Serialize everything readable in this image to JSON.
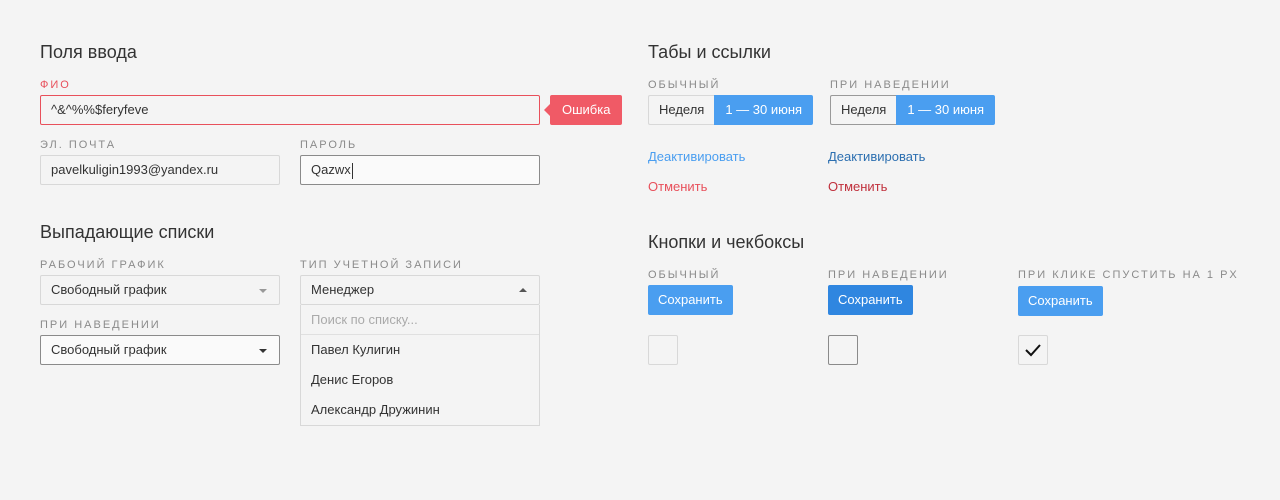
{
  "inputs": {
    "title": "Поля ввода",
    "fio_label": "ФИО",
    "fio_value": "^&^%%$feryfeve",
    "error_tooltip": "Ошибка",
    "email_label": "ЭЛ. ПОЧТА",
    "email_value": "pavelkuligin1993@yandex.ru",
    "password_label": "ПАРОЛЬ",
    "password_value": "Qazwx"
  },
  "dropdowns": {
    "title": "Выпадающие списки",
    "schedule_label": "РАБОЧИЙ ГРАФИК",
    "schedule_value": "Свободный график",
    "hover_label": "ПРИ НАВЕДЕНИИ",
    "hover_value": "Свободный график",
    "account_label": "ТИП УЧЕТНОЙ ЗАПИСИ",
    "account_value": "Менеджер",
    "search_placeholder": "Поиск по списку...",
    "options": [
      "Павел Кулигин",
      "Денис Егоров",
      "Александр Дружинин"
    ]
  },
  "tabs_links": {
    "title": "Табы и ссылки",
    "normal_label": "ОБЫЧНЫЙ",
    "hover_label": "ПРИ НАВЕДЕНИИ",
    "tab_week": "Неделя",
    "tab_range": "1 — 30 июня",
    "deactivate": "Деактивировать",
    "cancel": "Отменить"
  },
  "buttons": {
    "title": "Кнопки и чекбоксы",
    "normal_label": "ОБЫЧНЫЙ",
    "hover_label": "ПРИ НАВЕДЕНИИ",
    "press_label": "ПРИ КЛИКЕ СПУСТИТЬ НА 1 px",
    "save": "Сохранить"
  },
  "colors": {
    "accent": "#4a9ef0",
    "accent_hover": "#2f86e0",
    "error": "#e8505b",
    "link": "#4a9ef0",
    "link_hover": "#2c6fb0",
    "cancel": "#e8505b",
    "cancel_hover": "#c0303c"
  }
}
